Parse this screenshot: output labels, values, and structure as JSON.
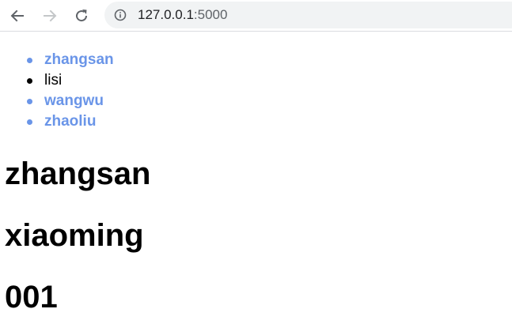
{
  "browser": {
    "url_host": "127.0.0.1",
    "url_port": ":5000",
    "back_icon": "arrow-left-icon",
    "forward_icon": "arrow-right-icon",
    "reload_icon": "reload-icon",
    "info_icon": "info-icon"
  },
  "colors": {
    "link": "#6a95e8",
    "text": "#000000",
    "omnibox_bg": "#f1f3f4",
    "icon_active": "#5f6368",
    "icon_disabled": "#c4c7c9"
  },
  "list": {
    "items": [
      {
        "label": "zhangsan",
        "is_link": true
      },
      {
        "label": "lisi",
        "is_link": false
      },
      {
        "label": "wangwu",
        "is_link": true
      },
      {
        "label": "zhaoliu",
        "is_link": true
      }
    ]
  },
  "headings": {
    "first": "zhangsan",
    "second": "xiaoming",
    "third": "001"
  }
}
